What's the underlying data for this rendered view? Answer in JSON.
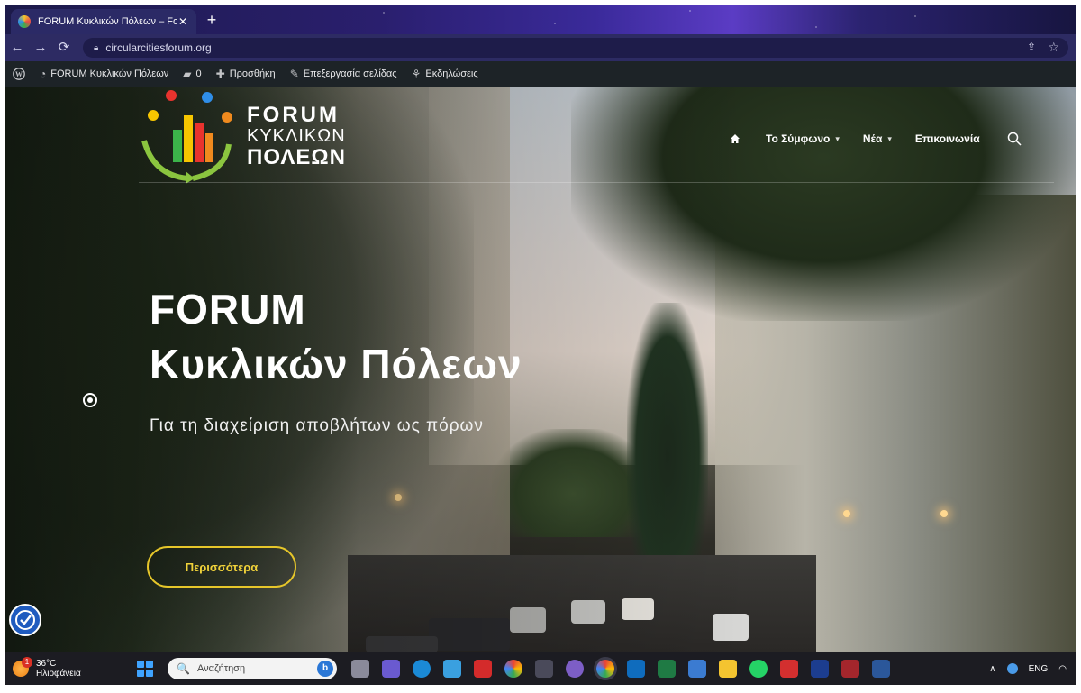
{
  "browser": {
    "tab_title": "FORUM Κυκλικών Πόλεων – Foru",
    "tab_close": "✕",
    "new_tab": "+",
    "back": "←",
    "forward": "→",
    "reload": "⟳",
    "url": "circularcitiesforum.org",
    "share": "⇪",
    "bookmark": "☆"
  },
  "wp_admin_bar": {
    "wp_logo": "W",
    "site_name": "FORUM Κυκλικών Πόλεων",
    "comments_count": "0",
    "add_new": "Προσθήκη",
    "edit_page": "Επεξεργασία σελίδας",
    "events": "Εκδηλώσεις"
  },
  "site": {
    "logo": {
      "line1": "FORUM",
      "line2": "ΚΥΚΛΙΚΩΝ",
      "line3": "ΠΟΛΕΩΝ"
    },
    "nav": {
      "items": [
        {
          "label": "Το Σύμφωνο",
          "has_dropdown": true
        },
        {
          "label": "Νέα",
          "has_dropdown": true
        },
        {
          "label": "Επικοινωνία",
          "has_dropdown": false
        }
      ],
      "caret": "▾"
    },
    "hero": {
      "title_line1": "FORUM",
      "title_line2": "Κυκλικών Πόλεων",
      "subtitle": "Για τη διαχείριση αποβλήτων ως πόρων",
      "cta": "Περισσότερα"
    }
  },
  "taskbar": {
    "weather_temp": "36°C",
    "weather_desc": "Ηλιοφάνεια",
    "weather_badge": "1",
    "search_placeholder": "Αναζήτηση",
    "search_glyph": "🔍",
    "bing": "b",
    "tray": {
      "up_arrow": "∧",
      "lang": "ENG"
    }
  },
  "colors": {
    "accent_yellow": "#e6c62a",
    "tab_bg": "#2b2a66",
    "wp_bar": "#1d2327"
  }
}
